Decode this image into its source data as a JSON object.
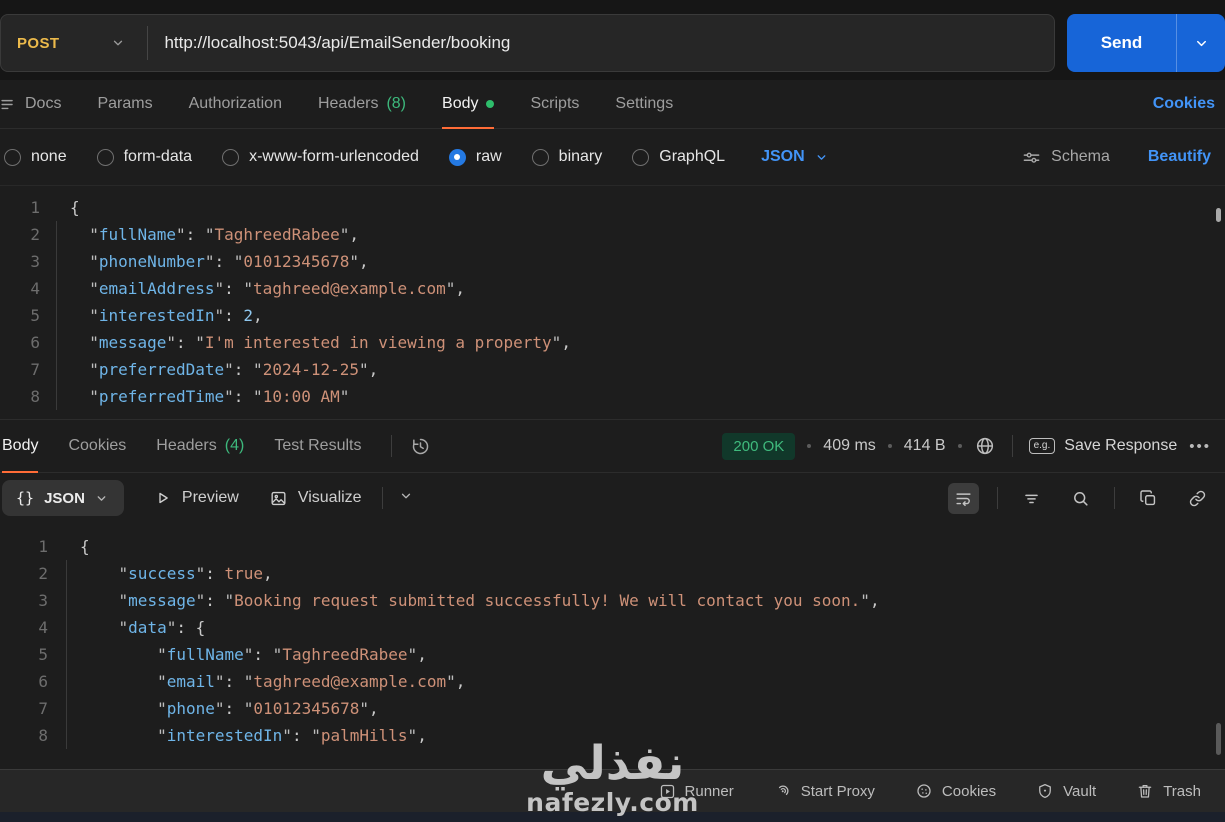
{
  "request_bar": {
    "method": "POST",
    "url": "http://localhost:5043/api/EmailSender/booking",
    "send_label": "Send"
  },
  "tabs": {
    "docs": "Docs",
    "params": "Params",
    "authorization": "Authorization",
    "headers": "Headers",
    "headers_count": "(8)",
    "body": "Body",
    "scripts": "Scripts",
    "settings": "Settings",
    "cookies_link": "Cookies"
  },
  "body_options": {
    "none": "none",
    "form_data": "form-data",
    "urlencoded": "x-www-form-urlencoded",
    "raw": "raw",
    "binary": "binary",
    "graphql": "GraphQL",
    "format": "JSON",
    "schema": "Schema",
    "beautify": "Beautify"
  },
  "request_editor": {
    "lines": [
      {
        "n": "1",
        "t": [
          [
            "p",
            "{"
          ]
        ]
      },
      {
        "n": "2",
        "t": [
          [
            "w",
            "  "
          ],
          [
            "k",
            "fullName"
          ],
          [
            "p",
            ": "
          ],
          [
            "s",
            "TaghreedRabee"
          ],
          [
            "p",
            ","
          ]
        ]
      },
      {
        "n": "3",
        "t": [
          [
            "w",
            "  "
          ],
          [
            "k",
            "phoneNumber"
          ],
          [
            "p",
            ": "
          ],
          [
            "s",
            "01012345678"
          ],
          [
            "p",
            ","
          ]
        ]
      },
      {
        "n": "4",
        "t": [
          [
            "w",
            "  "
          ],
          [
            "k",
            "emailAddress"
          ],
          [
            "p",
            ": "
          ],
          [
            "s",
            "taghreed@example.com"
          ],
          [
            "p",
            ","
          ]
        ]
      },
      {
        "n": "5",
        "t": [
          [
            "w",
            "  "
          ],
          [
            "k",
            "interestedIn"
          ],
          [
            "p",
            ": "
          ],
          [
            "n2",
            "2"
          ],
          [
            "p",
            ","
          ]
        ]
      },
      {
        "n": "6",
        "t": [
          [
            "w",
            "  "
          ],
          [
            "k",
            "message"
          ],
          [
            "p",
            ": "
          ],
          [
            "s",
            "I'm interested in viewing a property"
          ],
          [
            "p",
            ","
          ]
        ]
      },
      {
        "n": "7",
        "t": [
          [
            "w",
            "  "
          ],
          [
            "k",
            "preferredDate"
          ],
          [
            "p",
            ": "
          ],
          [
            "s",
            "2024-12-25"
          ],
          [
            "p",
            ","
          ]
        ]
      },
      {
        "n": "8",
        "t": [
          [
            "w",
            "  "
          ],
          [
            "k",
            "preferredTime"
          ],
          [
            "p",
            ": "
          ],
          [
            "s",
            "10:00 AM"
          ]
        ]
      }
    ]
  },
  "response": {
    "tabs": {
      "body": "Body",
      "cookies": "Cookies",
      "headers": "Headers",
      "headers_count": "(4)",
      "test_results": "Test Results"
    },
    "status": {
      "code_text": "200 OK",
      "time": "409 ms",
      "size": "414 B"
    },
    "eg_label": "e.g.",
    "save_label": "Save Response",
    "more_label": "•••",
    "toolbar": {
      "braces": "{}",
      "format": "JSON",
      "preview": "Preview",
      "visualize": "Visualize"
    },
    "editor": {
      "lines": [
        {
          "n": "1",
          "t": [
            [
              "p",
              "{"
            ]
          ]
        },
        {
          "n": "2",
          "t": [
            [
              "w",
              "    "
            ],
            [
              "k",
              "success"
            ],
            [
              "p",
              ": "
            ],
            [
              "b",
              "true"
            ],
            [
              "p",
              ","
            ]
          ]
        },
        {
          "n": "3",
          "t": [
            [
              "w",
              "    "
            ],
            [
              "k",
              "message"
            ],
            [
              "p",
              ": "
            ],
            [
              "s",
              "Booking request submitted successfully! We will contact you soon."
            ],
            [
              "p",
              ","
            ]
          ]
        },
        {
          "n": "4",
          "t": [
            [
              "w",
              "    "
            ],
            [
              "k",
              "data"
            ],
            [
              "p",
              ": {"
            ]
          ]
        },
        {
          "n": "5",
          "t": [
            [
              "w",
              "        "
            ],
            [
              "k",
              "fullName"
            ],
            [
              "p",
              ": "
            ],
            [
              "s",
              "TaghreedRabee"
            ],
            [
              "p",
              ","
            ]
          ]
        },
        {
          "n": "6",
          "t": [
            [
              "w",
              "        "
            ],
            [
              "k",
              "email"
            ],
            [
              "p",
              ": "
            ],
            [
              "s",
              "taghreed@example.com"
            ],
            [
              "p",
              ","
            ]
          ]
        },
        {
          "n": "7",
          "t": [
            [
              "w",
              "        "
            ],
            [
              "k",
              "phone"
            ],
            [
              "p",
              ": "
            ],
            [
              "s",
              "01012345678"
            ],
            [
              "p",
              ","
            ]
          ]
        },
        {
          "n": "8",
          "t": [
            [
              "w",
              "        "
            ],
            [
              "k",
              "interestedIn"
            ],
            [
              "p",
              ": "
            ],
            [
              "s",
              "palmHills"
            ],
            [
              "p",
              ","
            ]
          ]
        }
      ]
    }
  },
  "footer": {
    "runner": "Runner",
    "start_proxy": "Start Proxy",
    "cookies": "Cookies",
    "vault": "Vault",
    "trash": "Trash"
  },
  "watermark": {
    "arabic": "نفذلي",
    "domain": "nafezly.com"
  },
  "colors": {
    "method_post": "#ecba4b",
    "send_button": "#1765d8",
    "active_tab_underline": "#ff6c37",
    "count_green": "#3db87c",
    "link_blue": "#4294f7",
    "status_green": "#3fba7d",
    "status_badge_bg": "#11382a",
    "json_key": "#6fb5e8",
    "json_string": "#ce9178",
    "background": "#1d1d1d"
  }
}
